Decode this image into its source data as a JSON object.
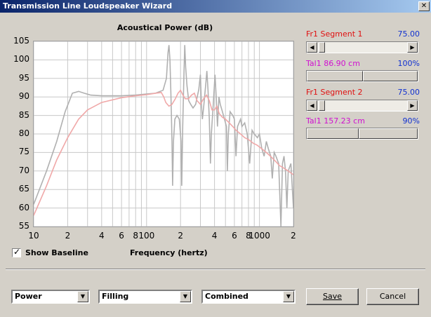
{
  "window": {
    "title": "Transmission Line Loudspeaker Wizard",
    "close_glyph": "✕"
  },
  "chart_title": "Acoustical Power (dB)",
  "baseline_checkbox": {
    "label": "Show Baseline",
    "checked": true
  },
  "controls": {
    "seg1": {
      "label": "Fr1  Segment 1",
      "value": "75.00"
    },
    "tal1a": {
      "label": "Tal1  86.90 cm",
      "value": "100%"
    },
    "seg2": {
      "label": "Fr1  Segment 2",
      "value": "75.00"
    },
    "tal1b": {
      "label": "Tal1  157.23 cm",
      "value": "90%"
    }
  },
  "dropdowns": {
    "d1": "Power",
    "d2": "Filling",
    "d3": "Combined"
  },
  "buttons": {
    "save": "Save",
    "cancel": "Cancel"
  },
  "icons": {
    "arrow_left": "◀",
    "arrow_right": "▶",
    "dropdown": "▼"
  },
  "chart_data": {
    "type": "line",
    "title": "Acoustical Power (dB)",
    "xlabel": "Frequency (hertz)",
    "ylabel": "",
    "x_scale": "log",
    "xlim": [
      10,
      2000
    ],
    "ylim": [
      55,
      105
    ],
    "yticks": [
      "105",
      "100",
      "95",
      "90",
      "85",
      "80",
      "75",
      "70",
      "65",
      "60",
      "55"
    ],
    "xticks": [
      {
        "v": 10,
        "label": "10"
      },
      {
        "v": 20,
        "label": "2"
      },
      {
        "v": 40,
        "label": "4"
      },
      {
        "v": 60,
        "label": "6"
      },
      {
        "v": 80,
        "label": "8"
      },
      {
        "v": 100,
        "label": "100"
      },
      {
        "v": 200,
        "label": "2"
      },
      {
        "v": 400,
        "label": "4"
      },
      {
        "v": 600,
        "label": "6"
      },
      {
        "v": 800,
        "label": "8"
      },
      {
        "v": 1000,
        "label": "1000"
      },
      {
        "v": 2000,
        "label": "2"
      }
    ],
    "grid": true,
    "series": [
      {
        "color": "#b0b0b0",
        "points": [
          [
            10,
            61
          ],
          [
            13,
            70
          ],
          [
            16,
            78
          ],
          [
            19,
            86
          ],
          [
            22,
            91
          ],
          [
            25,
            91.5
          ],
          [
            28,
            91
          ],
          [
            32,
            90.5
          ],
          [
            40,
            90.3
          ],
          [
            60,
            90.3
          ],
          [
            80,
            90.5
          ],
          [
            100,
            90.8
          ],
          [
            120,
            91
          ],
          [
            140,
            91.8
          ],
          [
            150,
            95
          ],
          [
            155,
            102
          ],
          [
            158,
            104
          ],
          [
            161,
            100
          ],
          [
            164,
            92
          ],
          [
            166,
            85
          ],
          [
            168,
            78
          ],
          [
            170,
            66
          ],
          [
            173,
            78
          ],
          [
            178,
            84
          ],
          [
            186,
            85
          ],
          [
            195,
            84
          ],
          [
            202,
            78
          ],
          [
            205,
            66
          ],
          [
            209,
            82
          ],
          [
            214,
            95
          ],
          [
            218,
            104
          ],
          [
            222,
            98
          ],
          [
            228,
            93
          ],
          [
            236,
            89
          ],
          [
            246,
            88
          ],
          [
            258,
            87
          ],
          [
            272,
            88
          ],
          [
            290,
            92
          ],
          [
            300,
            96
          ],
          [
            306,
            88
          ],
          [
            312,
            84
          ],
          [
            320,
            87
          ],
          [
            336,
            94
          ],
          [
            342,
            97
          ],
          [
            350,
            92
          ],
          [
            360,
            84
          ],
          [
            368,
            72
          ],
          [
            375,
            80
          ],
          [
            390,
            88
          ],
          [
            404,
            96
          ],
          [
            414,
            90
          ],
          [
            425,
            82
          ],
          [
            438,
            90
          ],
          [
            450,
            88
          ],
          [
            470,
            86
          ],
          [
            490,
            84
          ],
          [
            510,
            82
          ],
          [
            520,
            70
          ],
          [
            530,
            80
          ],
          [
            550,
            86
          ],
          [
            580,
            85
          ],
          [
            600,
            84
          ],
          [
            620,
            74
          ],
          [
            640,
            82
          ],
          [
            680,
            84
          ],
          [
            700,
            82
          ],
          [
            740,
            83
          ],
          [
            780,
            80
          ],
          [
            820,
            72
          ],
          [
            860,
            81
          ],
          [
            900,
            80
          ],
          [
            960,
            79
          ],
          [
            1000,
            80
          ],
          [
            1050,
            76
          ],
          [
            1100,
            74
          ],
          [
            1150,
            78
          ],
          [
            1200,
            76
          ],
          [
            1260,
            74
          ],
          [
            1300,
            68
          ],
          [
            1350,
            75
          ],
          [
            1400,
            74
          ],
          [
            1480,
            72
          ],
          [
            1550,
            55
          ],
          [
            1600,
            72
          ],
          [
            1650,
            74
          ],
          [
            1700,
            70
          ],
          [
            1750,
            60
          ],
          [
            1800,
            70
          ],
          [
            1900,
            72
          ],
          [
            2000,
            60
          ]
        ]
      },
      {
        "color": "#f0a8a8",
        "points": [
          [
            10,
            58
          ],
          [
            13,
            66
          ],
          [
            16,
            73
          ],
          [
            20,
            79
          ],
          [
            25,
            84
          ],
          [
            30,
            86.5
          ],
          [
            40,
            88.5
          ],
          [
            60,
            89.8
          ],
          [
            80,
            90.3
          ],
          [
            100,
            90.6
          ],
          [
            120,
            91
          ],
          [
            135,
            91.2
          ],
          [
            142,
            90
          ],
          [
            148,
            88.5
          ],
          [
            158,
            87.5
          ],
          [
            168,
            88
          ],
          [
            180,
            89.5
          ],
          [
            190,
            91
          ],
          [
            200,
            91.8
          ],
          [
            210,
            90.5
          ],
          [
            220,
            89.5
          ],
          [
            235,
            89.5
          ],
          [
            250,
            90.5
          ],
          [
            265,
            91
          ],
          [
            280,
            89
          ],
          [
            300,
            88
          ],
          [
            320,
            89.5
          ],
          [
            340,
            90.5
          ],
          [
            360,
            89
          ],
          [
            380,
            86.5
          ],
          [
            400,
            86.5
          ],
          [
            420,
            87.5
          ],
          [
            440,
            85.5
          ],
          [
            470,
            84.5
          ],
          [
            500,
            84
          ],
          [
            540,
            83
          ],
          [
            580,
            82
          ],
          [
            620,
            81
          ],
          [
            680,
            80
          ],
          [
            740,
            79
          ],
          [
            800,
            78.5
          ],
          [
            880,
            77.5
          ],
          [
            950,
            77
          ],
          [
            1000,
            76.5
          ],
          [
            1100,
            75.5
          ],
          [
            1200,
            74.5
          ],
          [
            1300,
            73.5
          ],
          [
            1400,
            72.5
          ],
          [
            1500,
            71.5
          ],
          [
            1600,
            71
          ],
          [
            1800,
            70
          ],
          [
            2000,
            69
          ]
        ]
      }
    ]
  }
}
